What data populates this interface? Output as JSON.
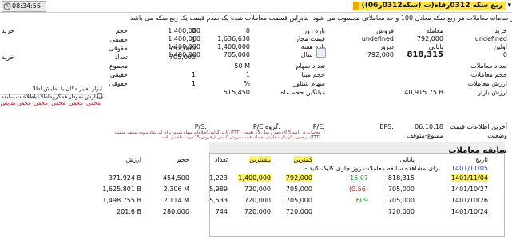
{
  "titlebar": {
    "time": "08:34:56",
    "title": "(ربع سکه 0312رفاه(ت (سکه0312ر06)"
  },
  "notice": {
    "line1": "در سامانه معاملات هر ربع سکه معادل 100 واحد معاملاتی محسوب می شود. بنابراین قسمت معاملات شده یک صدم قیمت یک ربع سکه می باشد."
  },
  "prices": {
    "buy_label": "خرید",
    "sell_label": "فروش",
    "trade_label": "معامله",
    "buy_value": "undefined",
    "sell_value": "undefined",
    "trade_value": "792,000",
    "price_range_label": "بازه روز",
    "price_range_low": "1,400,000",
    "price_range_high": "0",
    "first_label": "اولین",
    "first_value": "0",
    "yesterday_label": "دیروز",
    "yesterday_value": "792,000",
    "last_label": "پایانی",
    "last_value": "818,315",
    "week_range_label": "بازه هفته",
    "week_low": "1,400,000",
    "week_high": "1,400,000",
    "allowed_range_label": "قیمت مجاز",
    "allowed_low": "1,636,630",
    "allowed_high": "1,400,000",
    "year_range_label": "بازه سال",
    "year_low": "705,000",
    "year_high": "1,400,000"
  },
  "stats": {
    "trades_count_label": "تعداد معاملات",
    "trades_volume_label": "حجم معاملات",
    "trades_value_label": "ارزش معاملات",
    "market_value_label": "ارزش بازار",
    "last_info_label": "آخرین اطلاعات قیمت",
    "last_info_value": "06:10:18",
    "status_label": "وضعیت",
    "status_value": "ممنوع-متوقف",
    "shares_count_label": "تعداد سهام",
    "shares_count_value": "50 M",
    "base_vol_label": "حجم مبنا",
    "base_vol_value": "1",
    "float_label": "سهام شناور",
    "float_value": "%",
    "avg_vol_label": "میانگین حجم ماه",
    "avg_vol_value": "515,450",
    "market_value_value": "40,915.75 B",
    "eps_label": "EPS:",
    "pe_label": "P/E:",
    "group_pe_label": "P/E گروه:",
    "ps_label": "P/S:"
  },
  "buy_sell_people": {
    "buy_label": "خرید",
    "sell_label": "فروش",
    "vol_label": "حجم",
    "haghighi": "حقیقی",
    "hoghoghi": "حقوقی",
    "count_label": "تعداد",
    "total_label": "مجموع",
    "rows": [
      {
        "label": "حجم",
        "v1": "0",
        "v2": ""
      },
      {
        "label": "حقیقی",
        "v1": "1",
        "v2": ""
      },
      {
        "label": "حقوقی",
        "v1": "792,000",
        "v2": ""
      },
      {
        "label": "تعداد",
        "v1": "705,000",
        "v2": ""
      },
      {
        "label": "مجموع",
        "v1": "",
        "v2": ""
      },
      {
        "label": "حقیقی",
        "v1": "1",
        "v2": ""
      },
      {
        "label": "حقوقی",
        "v1": "1",
        "v2": ""
      }
    ]
  },
  "tools": {
    "label": "ابزار تغییر مکان یا نمایش اطلا",
    "items": [
      {
        "label": "سفارش",
        "sub": "مخفی"
      },
      {
        "label": "نمودار",
        "sub": "مخفی"
      },
      {
        "label": "همگروه",
        "sub": "مخفی"
      },
      {
        "label": "اطلاعیه",
        "sub": "مخفی"
      },
      {
        "label": "اطلاعات",
        "sub": "مخفی"
      },
      {
        "label": "سابقه",
        "sub": "نمایش"
      }
    ]
  },
  "warning": {
    "line1": "کاربر گرامی اطلاعات سهام شناور برای این نماد بزودی منتشر میشود.(TTT) - معاملات در دامنه 0.5 درصد و زمان 15 دقیقه",
    "line2": "در صورت ارسال سفارش معامله، قیمت فروش 0 بیش از فروش 15 درصد ماه می باشد.(TTT)"
  },
  "history": {
    "title": "سابقه معاملات",
    "hint": "- برای مشاهده سابقه معاملات روز جاری کلیک کنید",
    "headers": [
      "تاریخ",
      "پایانی",
      "",
      "کمترین",
      "بیشترین",
      "تعداد",
      "حجم",
      "ارزش"
    ],
    "rows": [
      {
        "date": "1401/11/05",
        "last": "",
        "change": "",
        "low": "",
        "high": "",
        "count": "",
        "vol": "",
        "value": ""
      },
      {
        "date": "1401/11/04",
        "last": "818,315",
        "change": "16.07",
        "low": "792,000",
        "high": "1,400,000",
        "count": "1,223",
        "vol": "454,500",
        "value": "371.924 B"
      },
      {
        "date": "1401/10/27",
        "last": "705,000",
        "change": "(0.56)",
        "low": "705,000",
        "high": "720,000",
        "count": "5,989",
        "vol": "2.306 M",
        "value": "1,625.801 B"
      },
      {
        "date": "1401/10/26",
        "last": "705,000",
        "change": "609",
        "low": "705,000",
        "high": "720,000",
        "count": "5,533",
        "vol": "2.114 M",
        "value": "1,498.755 B"
      },
      {
        "date": "1401/10/24",
        "last": "720,000",
        "change": "",
        "low": "720,000",
        "high": "720,000",
        "count": "744",
        "vol": "280,000",
        "value": "201.6 B"
      }
    ]
  }
}
